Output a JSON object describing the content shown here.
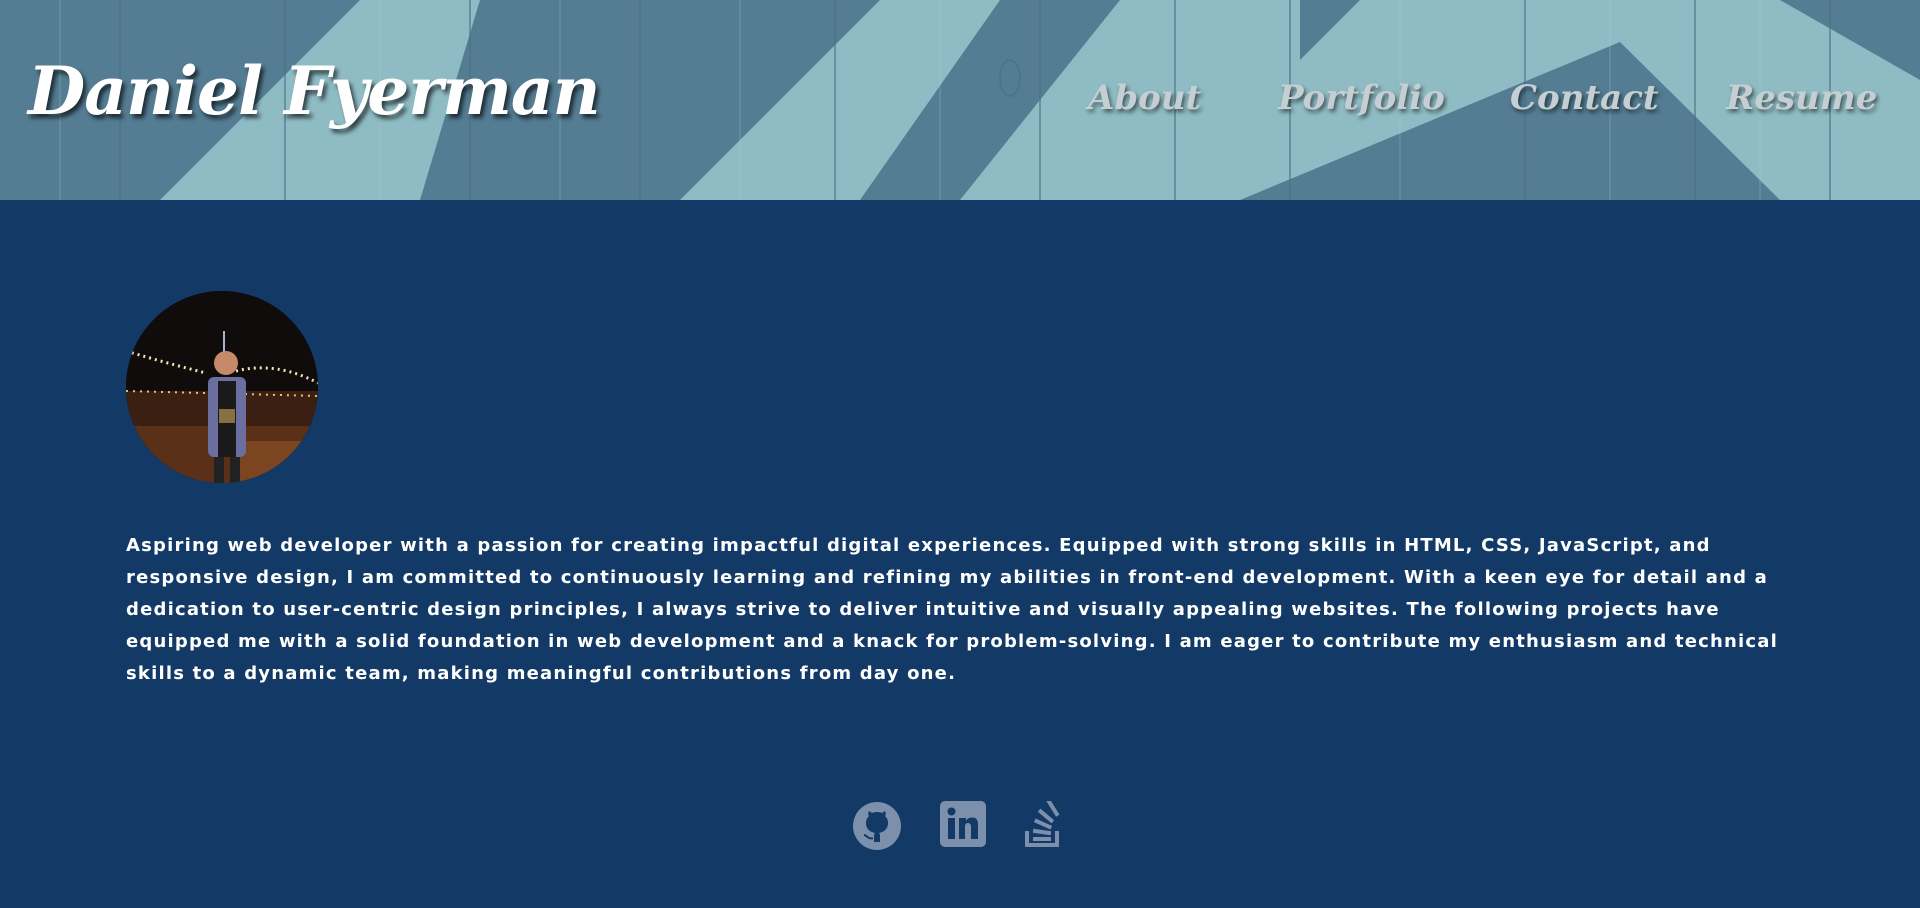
{
  "header": {
    "title": "Daniel Fyerman",
    "nav": [
      {
        "label": "About"
      },
      {
        "label": "Portfolio"
      },
      {
        "label": "Contact"
      },
      {
        "label": "Resume"
      }
    ]
  },
  "main": {
    "avatar_icon": "profile-photo",
    "bio": "Aspiring web developer with a passion for creating impactful digital experiences. Equipped with strong skills in HTML, CSS, JavaScript, and responsive design, I am committed to continuously learning and refining my abilities in front-end development. With a keen eye for detail and a dedication to user-centric design principles, I always strive to deliver intuitive and visually appealing websites. The following projects have equipped me with a solid foundation in web development and a knack for problem-solving. I am eager to contribute my enthusiasm and technical skills to a dynamic team, making meaningful contributions from day one."
  },
  "socials": [
    {
      "icon": "github-icon"
    },
    {
      "icon": "linkedin-icon"
    },
    {
      "icon": "stackoverflow-icon"
    }
  ],
  "colors": {
    "background": "#133966",
    "header_light": "#8fbcc4",
    "header_dark": "#547d93",
    "social_icon": "#7c8fab"
  }
}
